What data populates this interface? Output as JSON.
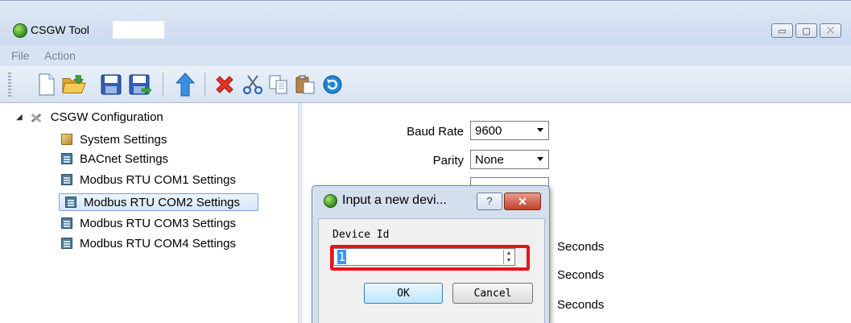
{
  "window": {
    "title": "CSGW Tool",
    "buttons": {
      "minimize": "▭",
      "maximize": "▢",
      "close": "⤬"
    }
  },
  "menu": {
    "file": "File",
    "action": "Action"
  },
  "toolbar": {
    "icons": [
      "new-file-icon",
      "open-folder-icon",
      "save-icon",
      "save-as-icon",
      "upload-icon",
      "delete-icon",
      "cut-icon",
      "copy-icon",
      "paste-icon",
      "refresh-icon"
    ]
  },
  "tree": {
    "root": "CSGW Configuration",
    "items": [
      {
        "label": "System Settings"
      },
      {
        "label": "BACnet Settings"
      },
      {
        "label": "Modbus RTU COM1 Settings"
      },
      {
        "label": "Modbus RTU COM2 Settings"
      },
      {
        "label": "Modbus RTU COM3 Settings"
      },
      {
        "label": "Modbus RTU COM4 Settings"
      }
    ]
  },
  "settings": {
    "baud_rate_label": "Baud Rate",
    "baud_rate_value": "9600",
    "parity_label": "Parity",
    "parity_value": "None",
    "seconds1": "Seconds",
    "seconds2": "Seconds",
    "seconds3": "Seconds"
  },
  "dialog": {
    "title": "Input a new devi...",
    "help": "?",
    "close": "✕",
    "field_label": "Device Id",
    "field_value": "1",
    "ok": "OK",
    "cancel": "Cancel"
  }
}
